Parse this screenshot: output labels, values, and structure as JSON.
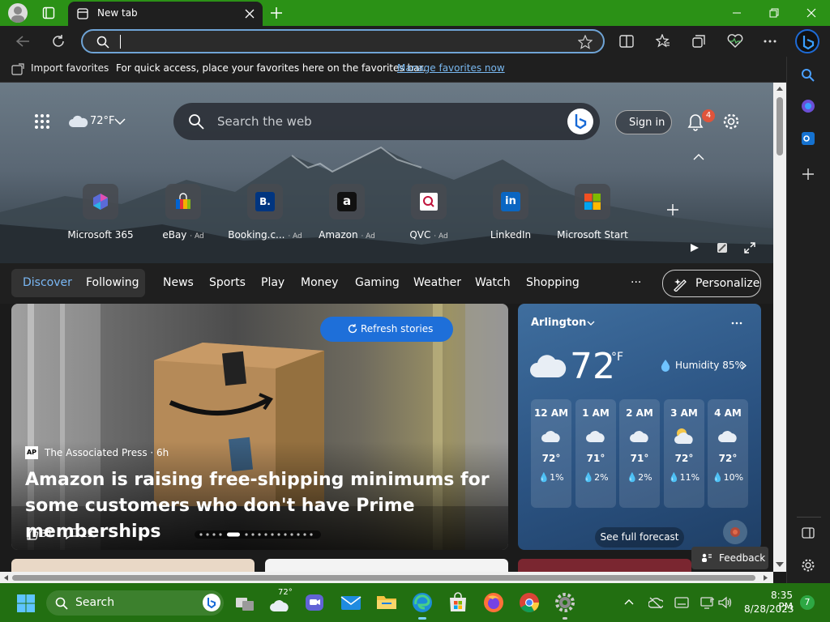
{
  "browser": {
    "tab_title": "New tab",
    "address_value": "",
    "favorites_bar": {
      "import_label": "Import favorites",
      "message": "For quick access, place your favorites here on the favorites bar.",
      "manage_link": "Manage favorites now"
    }
  },
  "newtab": {
    "weather_temp": "72°F",
    "search_placeholder": "Search the web",
    "sign_in": "Sign in",
    "notification_count": "4",
    "quick_links": [
      {
        "label": "Microsoft 365",
        "ad": ""
      },
      {
        "label": "eBay",
        "ad": "· Ad"
      },
      {
        "label": "Booking.c...",
        "ad": "· Ad"
      },
      {
        "label": "Amazon",
        "ad": "· Ad"
      },
      {
        "label": "QVC",
        "ad": "· Ad"
      },
      {
        "label": "LinkedIn",
        "ad": ""
      },
      {
        "label": "Microsoft Start",
        "ad": ""
      }
    ],
    "feed_tabs": [
      "Discover",
      "Following",
      "News",
      "Sports",
      "Play",
      "Money",
      "Gaming",
      "Weather",
      "Watch",
      "Shopping"
    ],
    "more": "···",
    "personalize": "Personalize",
    "refresh_stories": "Refresh stories",
    "story": {
      "source": "The Associated Press · 6h",
      "source_logo": "AP",
      "headline": "Amazon is raising free-shipping minimums for some customers who don't have Prime memberships",
      "likes": "31",
      "comments": "13"
    },
    "weather": {
      "location": "Arlington",
      "temp": "72",
      "unit": "°F",
      "humidity": "Humidity 85%",
      "hours": [
        {
          "time": "12 AM",
          "temp": "72°",
          "precip": "1%"
        },
        {
          "time": "1 AM",
          "temp": "71°",
          "precip": "2%"
        },
        {
          "time": "2 AM",
          "temp": "71°",
          "precip": "2%"
        },
        {
          "time": "3 AM",
          "temp": "72°",
          "precip": "11%"
        },
        {
          "time": "4 AM",
          "temp": "72°",
          "precip": "10%"
        }
      ],
      "forecast_button": "See full forecast"
    },
    "feedback": "Feedback"
  },
  "taskbar": {
    "search_label": "Search",
    "weather_badge": "72°",
    "time": "8:35 PM",
    "date": "8/28/2023",
    "notif_count": "7"
  }
}
